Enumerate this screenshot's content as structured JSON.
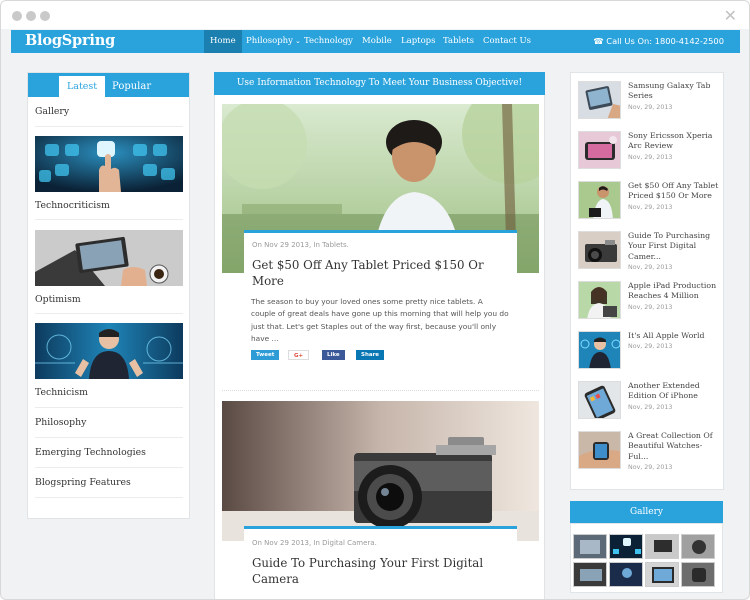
{
  "brand": "BlogSpring",
  "nav": {
    "items": [
      "Home",
      "Philosophy",
      "Technology",
      "Mobile",
      "Laptops",
      "Tablets",
      "Contact Us"
    ],
    "caret": "⌄",
    "phone": "Call Us On: 1800-4142-2500"
  },
  "left": {
    "tabs": [
      "Latest",
      "Popular"
    ],
    "categories": [
      "Gallery",
      "Technocriticism",
      "Optimism",
      "Technicism",
      "Philosophy",
      "Emerging Technologies",
      "Blogspring Features"
    ]
  },
  "center": {
    "banner": "Use Information Technology To Meet Your Business Objective!",
    "posts": [
      {
        "meta": "On Nov 29 2013, In Tablets.",
        "title": "Get $50 Off Any Tablet Priced $150 Or More",
        "excerpt": "The season to buy your loved ones some pretty nice tablets. A couple of great deals have gone up this morning that will help you do just that. Let's get Staples out of the way first, because you'll only have ...",
        "share": [
          "Tweet",
          "G+",
          "Like",
          "Share"
        ]
      },
      {
        "meta": "On Nov 29 2013, In Digital Camera.",
        "title": "Guide To Purchasing Your First Digital Camera"
      }
    ]
  },
  "right": {
    "items": [
      {
        "title": "Samsung Galaxy Tab Series",
        "date": "Nov, 29, 2013"
      },
      {
        "title": "Sony Ericsson Xperia Arc Review",
        "date": "Nov, 29, 2013"
      },
      {
        "title": "Get $50 Off Any Tablet Priced $150 Or More",
        "date": "Nov, 29, 2013"
      },
      {
        "title": "Guide To Purchasing Your First Digital Camer...",
        "date": "Nov, 29, 2013"
      },
      {
        "title": "Apple iPad Production Reaches 4 Million",
        "date": "Nov, 29, 2013"
      },
      {
        "title": "It's All Apple World",
        "date": "Nov, 29, 2013"
      },
      {
        "title": "Another Extended Edition Of iPhone",
        "date": "Nov, 29, 2013"
      },
      {
        "title": "A Great Collection Of Beautiful Watches-Ful...",
        "date": "Nov, 29, 2013"
      }
    ],
    "gallery_title": "Gallery"
  },
  "colors": {
    "accent": "#2aa3dd",
    "accent_dark": "#1b7fb0",
    "twitter": "#2c9bd6",
    "gplus": "#dd4b39",
    "facebook": "#3b5998",
    "linkedin": "#0a77b5"
  },
  "icons": {
    "phone": "☎",
    "close": "✕"
  }
}
